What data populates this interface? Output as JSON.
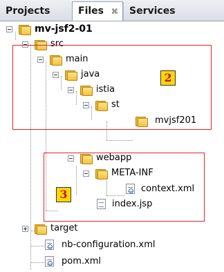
{
  "tabs": {
    "projects": "Projects",
    "files": "Files",
    "files_close": "⌘",
    "services": "Services"
  },
  "tree": {
    "root": "mv-jsf2-01",
    "src": "src",
    "main": "main",
    "java": "java",
    "istia": "istia",
    "st": "st",
    "mvjsf201": "mvjsf201",
    "webapp": "webapp",
    "meta_inf": "META-INF",
    "context_xml": "context.xml",
    "index_jsp": "index.jsp",
    "target": "target",
    "nb_configuration": "nb-configuration.xml",
    "pom": "pom.xml"
  },
  "annotations": {
    "box2": "2",
    "box3": "3"
  },
  "colors": {
    "callout_border": "#e0232a",
    "badge_fill": "#ffd700",
    "badge_text": "#c8102e"
  }
}
